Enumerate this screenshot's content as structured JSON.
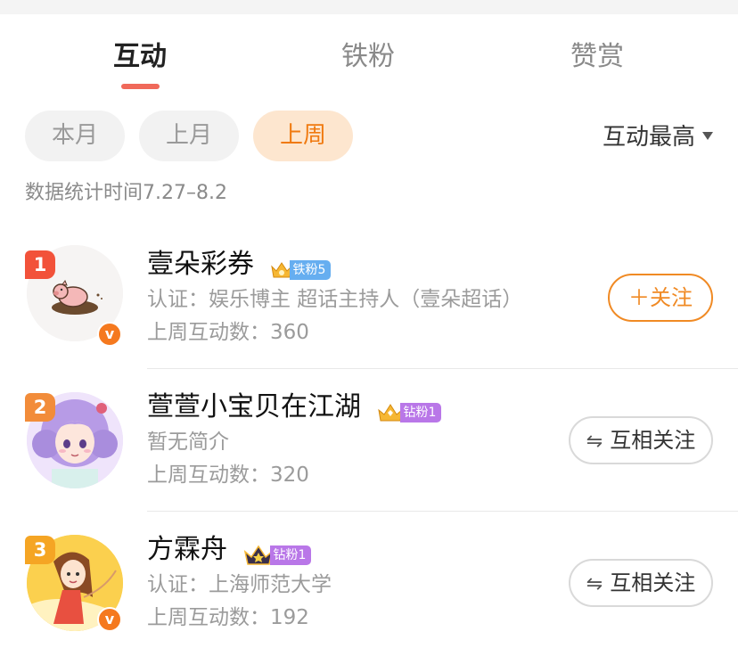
{
  "tabs": [
    {
      "label": "互动",
      "active": true
    },
    {
      "label": "铁粉",
      "active": false
    },
    {
      "label": "赞赏",
      "active": false
    }
  ],
  "filters": [
    {
      "label": "本月",
      "active": false
    },
    {
      "label": "上月",
      "active": false
    },
    {
      "label": "上周",
      "active": true
    }
  ],
  "sort": {
    "label": "互动最高"
  },
  "stat_time": "数据统计时间7.27–8.2",
  "users": [
    {
      "rank": "1",
      "name": "壹朵彩券",
      "fan_badge": "铁粉5",
      "description": "认证：娱乐博主 超话主持人（壹朵超话）",
      "count": "上周互动数：360",
      "button": "＋关注",
      "verified": "v"
    },
    {
      "rank": "2",
      "name": "萱萱小宝贝在江湖",
      "fan_badge": "钻粉1",
      "description": "暂无简介",
      "count": "上周互动数：320",
      "button": "互相关注"
    },
    {
      "rank": "3",
      "name": "方霖舟",
      "fan_badge": "钻粉1",
      "description": "认证：上海师范大学",
      "count": "上周互动数：192",
      "button": "互相关注",
      "verified": "v"
    }
  ],
  "colors": {
    "accent_orange": "#f08a24",
    "tab_underline": "#f0695a",
    "active_pill_bg": "#fde6cf",
    "tag_blue": "#66aef0",
    "tag_purple": "#b977e8"
  }
}
